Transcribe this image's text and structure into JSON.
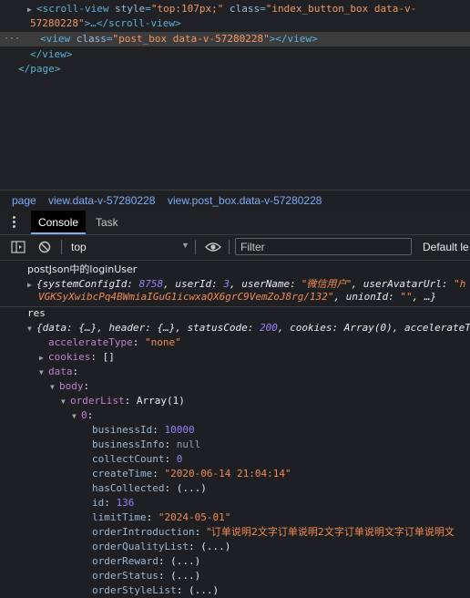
{
  "elements": {
    "line1_tag_open": "<scroll-view",
    "line1_attr1": "style",
    "line1_val1": "\"top:107px;\"",
    "line1_attr2": "class",
    "line1_val2": "\"index_button_box data-v-",
    "line2_val": "57280228\"",
    "line2_rest": ">…</scroll-view>",
    "line3_tag_open": "<view",
    "line3_attr": "class",
    "line3_val": "\"post_box data-v-57280228\"",
    "line3_close": "></view>",
    "line4": "</view>",
    "line5": "</page>"
  },
  "breadcrumbs": [
    "page",
    "view.data-v-57280228",
    "view.post_box.data-v-57280228"
  ],
  "drawer_tabs": [
    "Console",
    "Task"
  ],
  "toolbar": {
    "context": "top",
    "filter_placeholder": "Filter",
    "levels": "Default le"
  },
  "console": {
    "log1_label": "postJson中的loginUser",
    "log1_obj_a": "{systemConfigId: ",
    "log1_obj_num": "8758",
    "log1_obj_b": ", userId: ",
    "log1_obj_num2": "3",
    "log1_obj_c": ", userName: ",
    "log1_obj_str": "\"微信用户\"",
    "log1_obj_d": ", userAvatarUrl: ",
    "log1_obj_str2": "\"h",
    "log1_line2_str": "VGKSyXwibcPq4BWmiaIGuG1icwxaQX6grC9VemZoJ8rg/132\"",
    "log1_line2_rest": ", unionId: ",
    "log1_line2_str2": "\"\"",
    "log1_line2_end": ", …}",
    "res_label": "res",
    "res_summary_a": "{data: {…}, header: {…}, statusCode: ",
    "res_summary_num": "200",
    "res_summary_b": ", cookies: Array(0), accelerateT",
    "props": [
      {
        "key": "accelerateType",
        "value": "\"none\"",
        "kind": "str"
      },
      {
        "key": "cookies",
        "value": "[]",
        "kind": "plain"
      },
      {
        "key": "data",
        "value": "",
        "kind": "plain"
      },
      {
        "key": "body",
        "value": "",
        "kind": "plain"
      },
      {
        "key": "orderList",
        "value": "Array(1)",
        "kind": "plain"
      },
      {
        "key": "0",
        "value": "",
        "kind": "plain"
      }
    ],
    "fields": [
      {
        "key": "businessId",
        "value": "10000",
        "kind": "num"
      },
      {
        "key": "businessInfo",
        "value": "null",
        "kind": "nul"
      },
      {
        "key": "collectCount",
        "value": "0",
        "kind": "num"
      },
      {
        "key": "createTime",
        "value": "\"2020-06-14 21:04:14\"",
        "kind": "str"
      },
      {
        "key": "hasCollected",
        "value": "(...)",
        "kind": "plain"
      },
      {
        "key": "id",
        "value": "136",
        "kind": "num"
      },
      {
        "key": "limitTime",
        "value": "\"2024-05-01\"",
        "kind": "str"
      },
      {
        "key": "orderIntroduction",
        "value": "\"订单说明2文字订单说明2文字订单说明文字订单说明文",
        "kind": "cjk"
      },
      {
        "key": "orderQualityList",
        "value": "(...)",
        "kind": "plain"
      },
      {
        "key": "orderReward",
        "value": "(...)",
        "kind": "plain"
      },
      {
        "key": "orderStatus",
        "value": "(...)",
        "kind": "plain"
      },
      {
        "key": "orderStyleList",
        "value": "(...)",
        "kind": "plain"
      }
    ]
  }
}
